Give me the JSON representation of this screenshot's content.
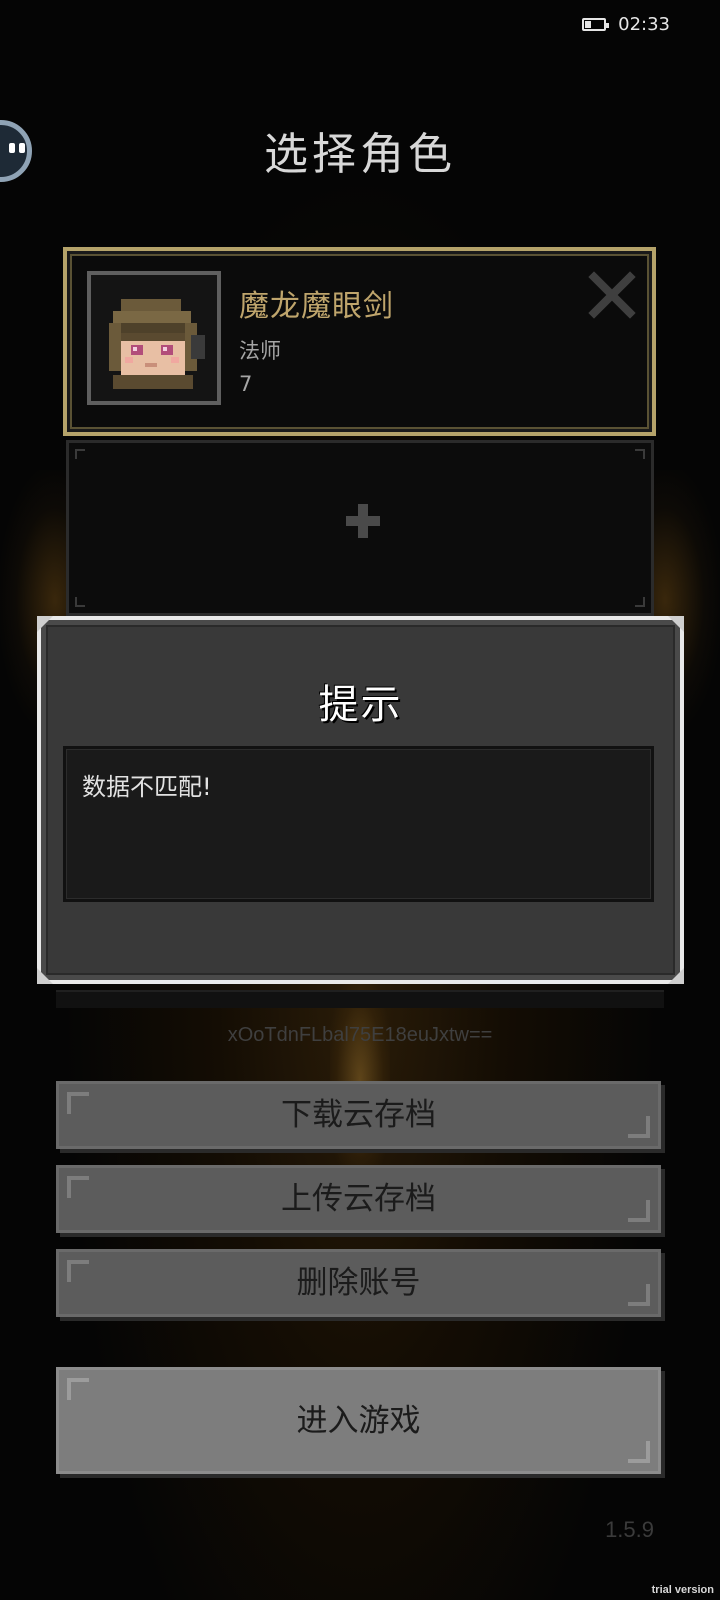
{
  "status_bar": {
    "time": "02:33",
    "battery_level": 0.35
  },
  "page": {
    "title": "选择角色"
  },
  "character_slots": [
    {
      "name": "魔龙魔眼剑",
      "class": "法师",
      "level": "7",
      "selected": true
    },
    {
      "empty": true,
      "add_icon": "plus-icon"
    }
  ],
  "dialog": {
    "title": "提示",
    "message": "数据不匹配!"
  },
  "account": {
    "id": "xOoTdnFLbal75E18euJxtw=="
  },
  "buttons": {
    "download_cloud_save": "下载云存档",
    "upload_cloud_save": "上传云存档",
    "delete_account": "删除账号",
    "enter_game": "进入游戏"
  },
  "footer": {
    "version": "1.5.9",
    "watermark": "trial version"
  },
  "colors": {
    "name_gold": "#bfa56c",
    "selected_border": "#b5a36a",
    "dialog_bg": "#393939",
    "button_gray": "#5c5c5c",
    "enter_button_gray": "#7d7d7d"
  }
}
